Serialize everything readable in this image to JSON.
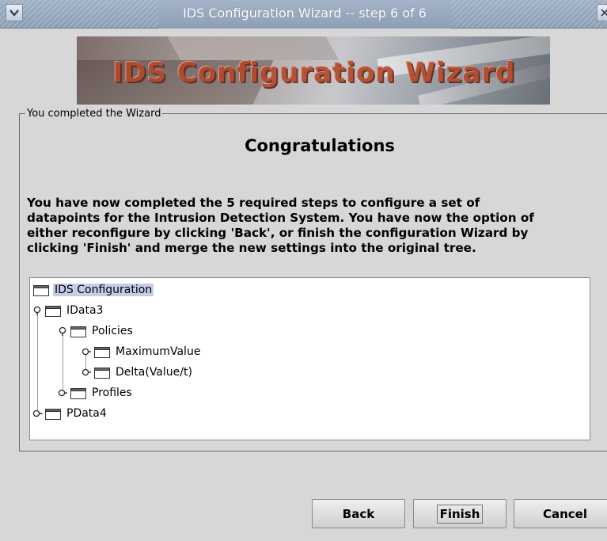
{
  "window": {
    "title": "IDS Configuration Wizard -- step 6 of 6",
    "menu_icon": "chevron-down-icon",
    "close_icon": "close-icon"
  },
  "banner": {
    "text": "IDS Configuration Wizard"
  },
  "group": {
    "legend": "You completed the Wizard"
  },
  "content": {
    "heading": "Congratulations",
    "paragraph_lines": [
      "You have now completed the 5 required steps to configure a set of",
      "datapoints for the Intrusion Detection System. You have now the option of",
      "either reconfigure by clicking 'Back', or finish the configuration Wizard by",
      "clicking 'Finish' and merge the new settings into the original tree."
    ]
  },
  "tree": {
    "root": "IDS Configuration",
    "nodes": [
      {
        "label": "IData3"
      },
      {
        "label": "Policies"
      },
      {
        "label": "MaximumValue"
      },
      {
        "label": "Delta(Value/t)"
      },
      {
        "label": "Profiles"
      },
      {
        "label": "PData4"
      }
    ]
  },
  "buttons": {
    "back": "Back",
    "finish": "Finish",
    "cancel": "Cancel"
  },
  "colors": {
    "titlebar": "#9fb0c4",
    "window_bg": "#d7d7d7",
    "banner_text": "#b5472a",
    "selection": "#c6cce8"
  }
}
